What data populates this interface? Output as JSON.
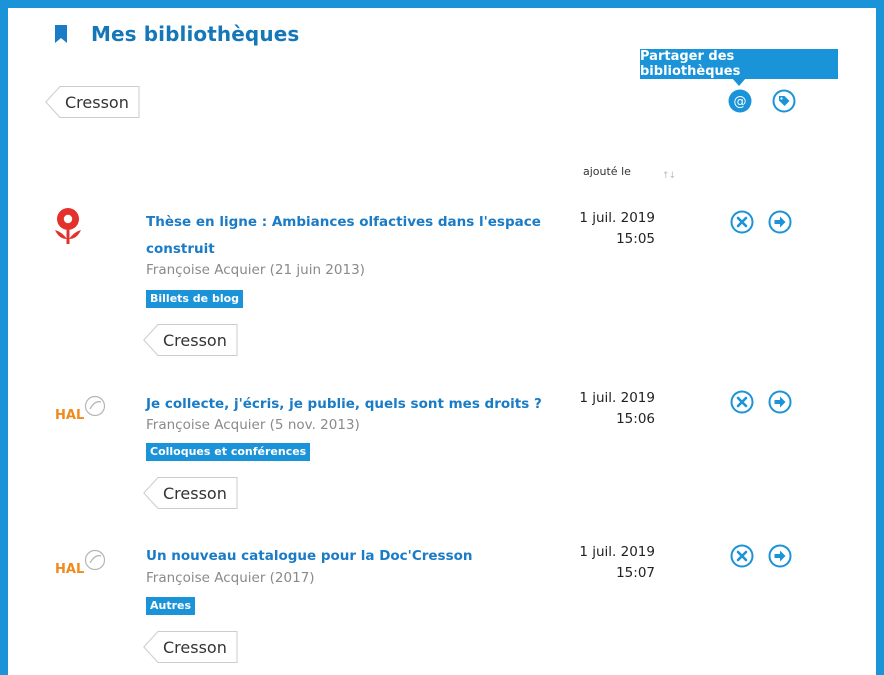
{
  "header": {
    "title": "Mes bibliothèques"
  },
  "library_tag": "Cresson",
  "tooltip": "Partager des bibliothèques",
  "table": {
    "column_added": "ajouté le"
  },
  "items": [
    {
      "title_line1": "Thèse en ligne : Ambiances olfactives dans l'espace",
      "title_line2": "construit",
      "author": "Françoise Acquier (21 juin 2013)",
      "category": "Billets de blog",
      "tag": "Cresson",
      "date": "1 juil. 2019",
      "time": "15:05",
      "source_icon": "flower-logo-icon"
    },
    {
      "title_line1": "Je collecte, j'écris, je publie, quels sont mes droits ?",
      "author": "Françoise Acquier (5 nov. 2013)",
      "category": "Colloques et conférences",
      "tag": "Cresson",
      "date": "1 juil. 2019",
      "time": "15:06",
      "source_icon": "hal-logo-icon",
      "source_text": "HAL"
    },
    {
      "title_line1": "Un nouveau catalogue pour la Doc'Cresson",
      "author": "Françoise Acquier (2017)",
      "category": "Autres",
      "tag": "Cresson",
      "date": "1 juil. 2019",
      "time": "15:07",
      "source_icon": "hal-logo-icon",
      "source_text": "HAL"
    }
  ],
  "colors": {
    "accent": "#1a93d8",
    "link": "#1a7bc6",
    "title": "#1577b8",
    "logo_red": "#e4312b",
    "hal_orange": "#f08a1c"
  }
}
